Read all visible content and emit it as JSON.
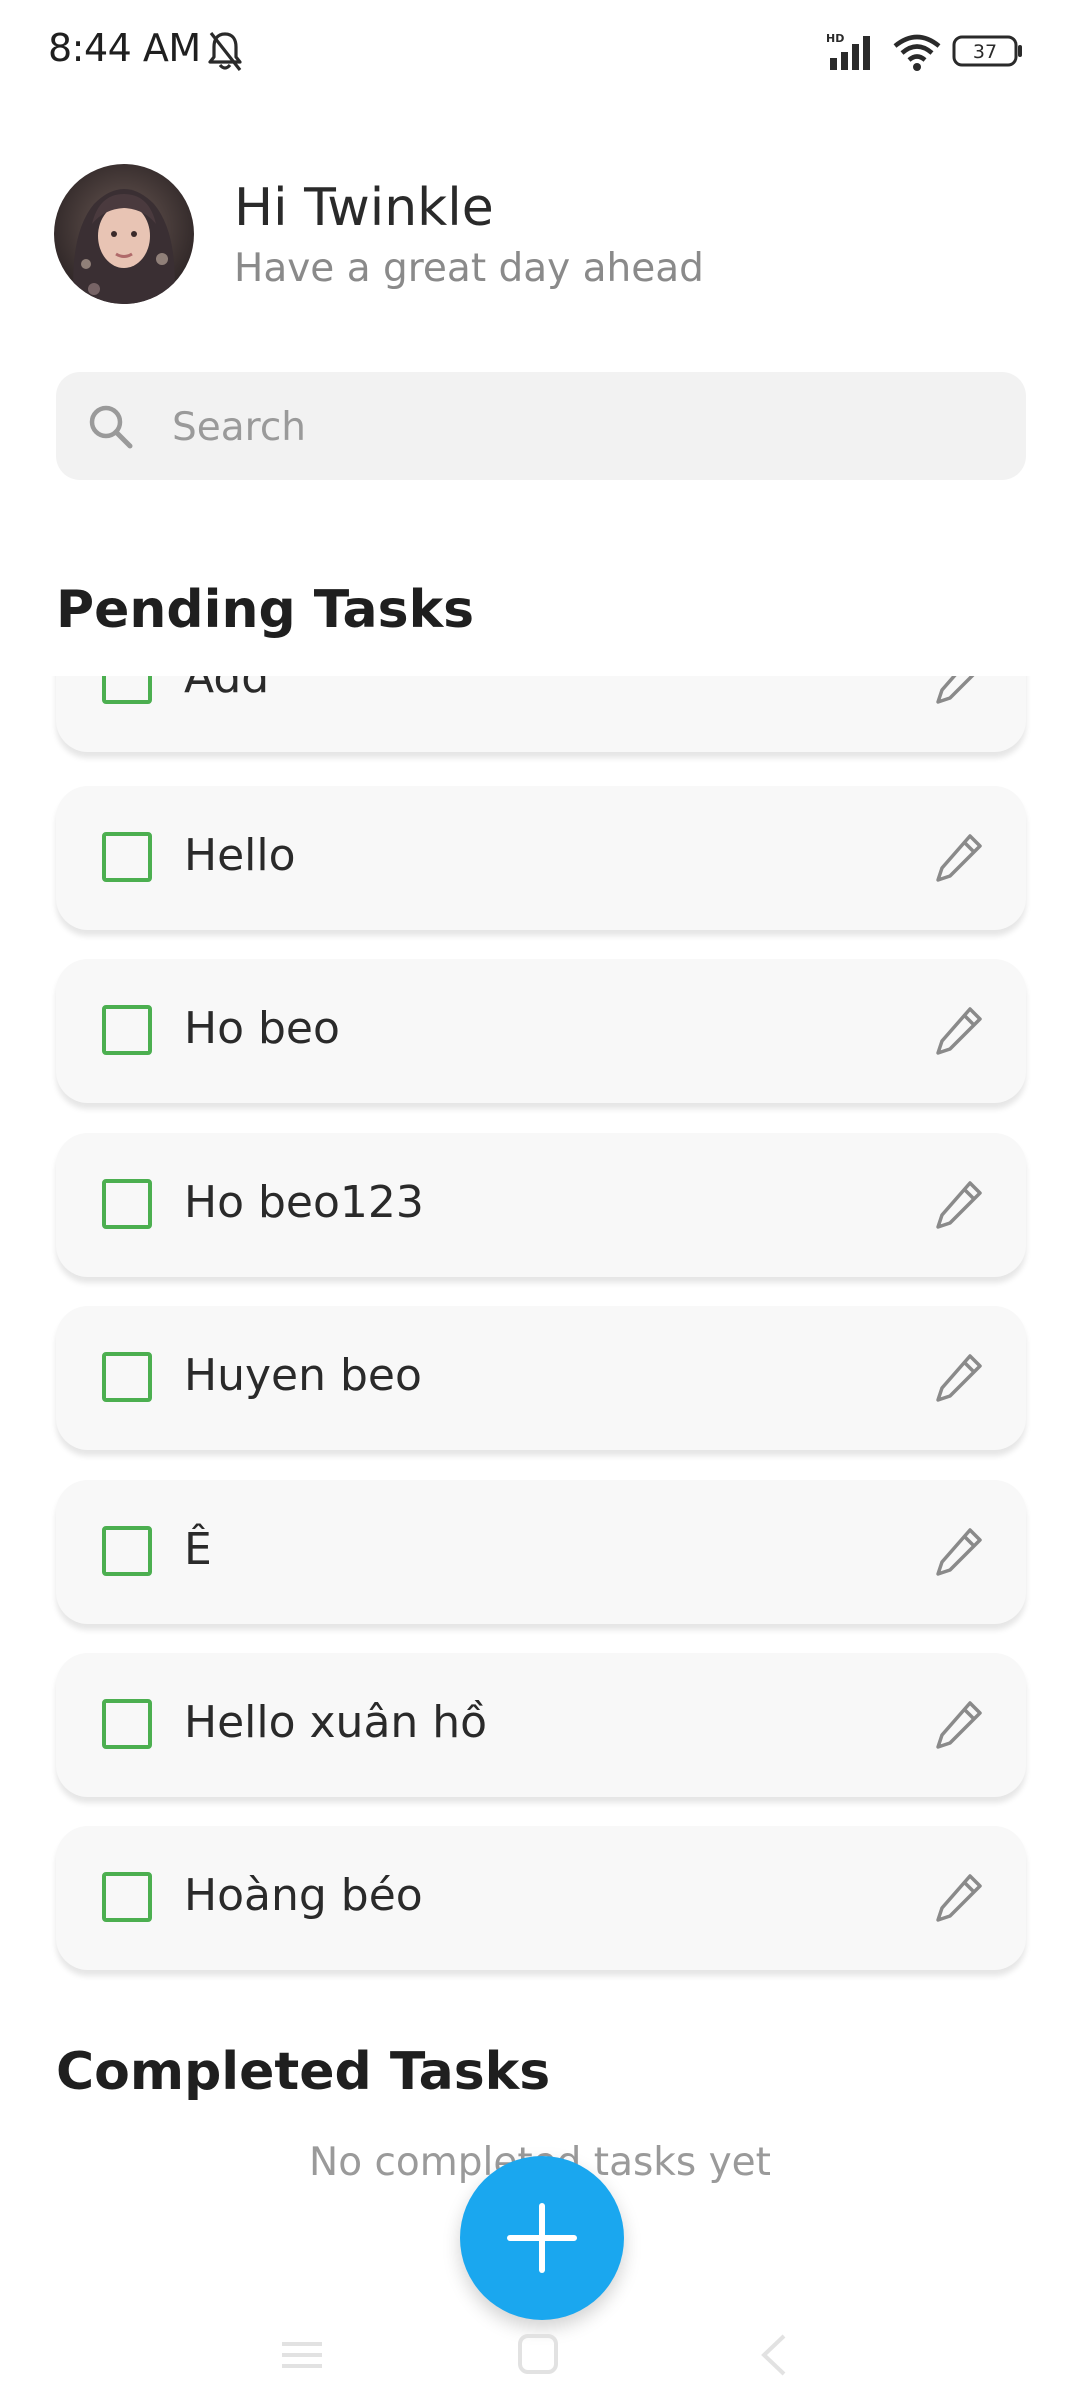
{
  "status_bar": {
    "time": "8:44 AM",
    "battery": "37",
    "network_badge": "HD",
    "icons": [
      "bell-off-icon",
      "signal-icon",
      "wifi-icon",
      "battery-icon"
    ]
  },
  "header": {
    "greeting": "Hi Twinkle",
    "subtitle": "Have a great day ahead"
  },
  "search": {
    "placeholder": "Search",
    "value": ""
  },
  "pending": {
    "title": "Pending Tasks",
    "tasks": [
      {
        "label": "Add",
        "checked": false
      },
      {
        "label": "Hello",
        "checked": false
      },
      {
        "label": "Ho beo",
        "checked": false
      },
      {
        "label": "Ho beo123",
        "checked": false
      },
      {
        "label": "Huyen beo",
        "checked": false
      },
      {
        "label": "Ê",
        "checked": false
      },
      {
        "label": "Hello xuân hồ",
        "checked": false
      },
      {
        "label": "Hoàng béo",
        "checked": false
      }
    ]
  },
  "completed": {
    "title": "Completed Tasks",
    "empty_message": "No completed tasks yet"
  },
  "colors": {
    "accent": "#1aa7ef",
    "checkbox": "#4caf50",
    "card": "#f8f8f8"
  }
}
